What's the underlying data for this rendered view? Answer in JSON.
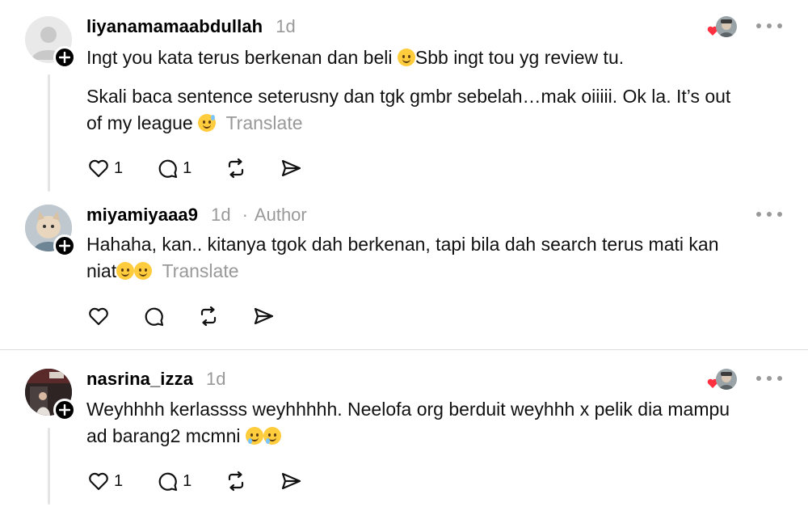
{
  "comments": [
    {
      "username": "liyanamamaabdullah",
      "time": "1d",
      "line1": "Ingt you kata terus berkenan dan beli ",
      "line1b": "Sbb ingt tou yg review tu.",
      "line2": "Skali baca sentence seterusny dan tgk gmbr sebelah…mak oiiiii. Ok la. It’s out",
      "line3": "of my league ",
      "translate": "Translate",
      "likes": "1",
      "replies": "1"
    },
    {
      "username": "miyamiyaaa9",
      "time": "1d",
      "separator": "·",
      "author_label": "Author",
      "line1": "Hahaha, kan.. kitanya tgok dah berkenan, tapi bila dah search terus mati kan",
      "line2": "niat",
      "translate": "Translate"
    },
    {
      "username": "nasrina_izza",
      "time": "1d",
      "line1": "Weyhhhh kerlassss weyhhhhh. Neelofa org berduit weyhhh x pelik dia mampu",
      "line2": "ad barang2 mcmni ",
      "likes": "1",
      "replies": "1"
    }
  ],
  "icons": {
    "like": "heart-outline-icon",
    "reply": "comment-bubble-icon",
    "repost": "repost-arrows-icon",
    "share": "send-paper-plane-icon",
    "more": "more-horizontal-icon",
    "follow": "plus-icon"
  },
  "colors": {
    "muted": "#999999",
    "liked_heart": "#ff3040"
  }
}
